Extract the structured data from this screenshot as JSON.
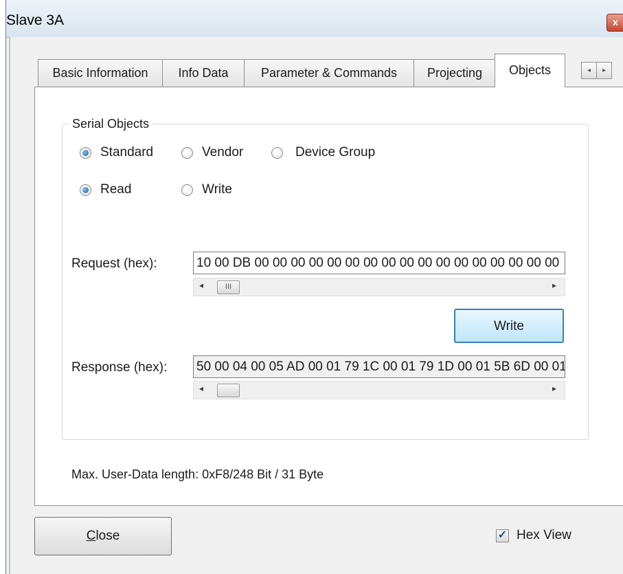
{
  "window": {
    "title": "Slave 3A",
    "close_glyph": "x"
  },
  "tabs": [
    {
      "label": "Basic Information",
      "active": false
    },
    {
      "label": "Info Data",
      "active": false
    },
    {
      "label": "Parameter & Commands",
      "active": false
    },
    {
      "label": "Projecting",
      "active": false
    },
    {
      "label": "Objects",
      "active": true
    }
  ],
  "tab_scroll": {
    "left_icon": "scroll-left-icon",
    "right_icon": "scroll-right-icon",
    "left_glyph": "◂",
    "right_glyph": "▸"
  },
  "serial_objects": {
    "group_label": "Serial Objects",
    "object_type_options": [
      {
        "label": "Standard",
        "checked": true
      },
      {
        "label": "Vendor",
        "checked": false
      },
      {
        "label": "Device Group",
        "checked": false
      }
    ],
    "direction_options": [
      {
        "label": "Read",
        "checked": true
      },
      {
        "label": "Write",
        "checked": false
      }
    ],
    "request_label": "Request (hex):",
    "request_value": "10 00 DB 00 00 00 00 00 00 00 00 00 00 00 00 00 00 00 00 00",
    "write_button": "Write",
    "response_label": "Response (hex):",
    "response_value": "50 00 04 00 05 AD 00 01 79 1C 00 01 79 1D 00 01 5B 6D 00 01",
    "scroll_left_glyph": "◂",
    "scroll_right_glyph": "▸",
    "scroll_thumb_grip": "III"
  },
  "max_user_data": "Max. User-Data length: 0xF8/248 Bit / 31 Byte",
  "footer": {
    "close_button": "Close",
    "close_mnemonic": "C",
    "close_rest": "lose",
    "hex_view_label": "Hex View",
    "hex_view_checked": true,
    "check_glyph": "✓"
  },
  "colors": {
    "accent": "#3c7fb1",
    "title_bar": "#dae4ef",
    "window_close": "#c4472f"
  }
}
